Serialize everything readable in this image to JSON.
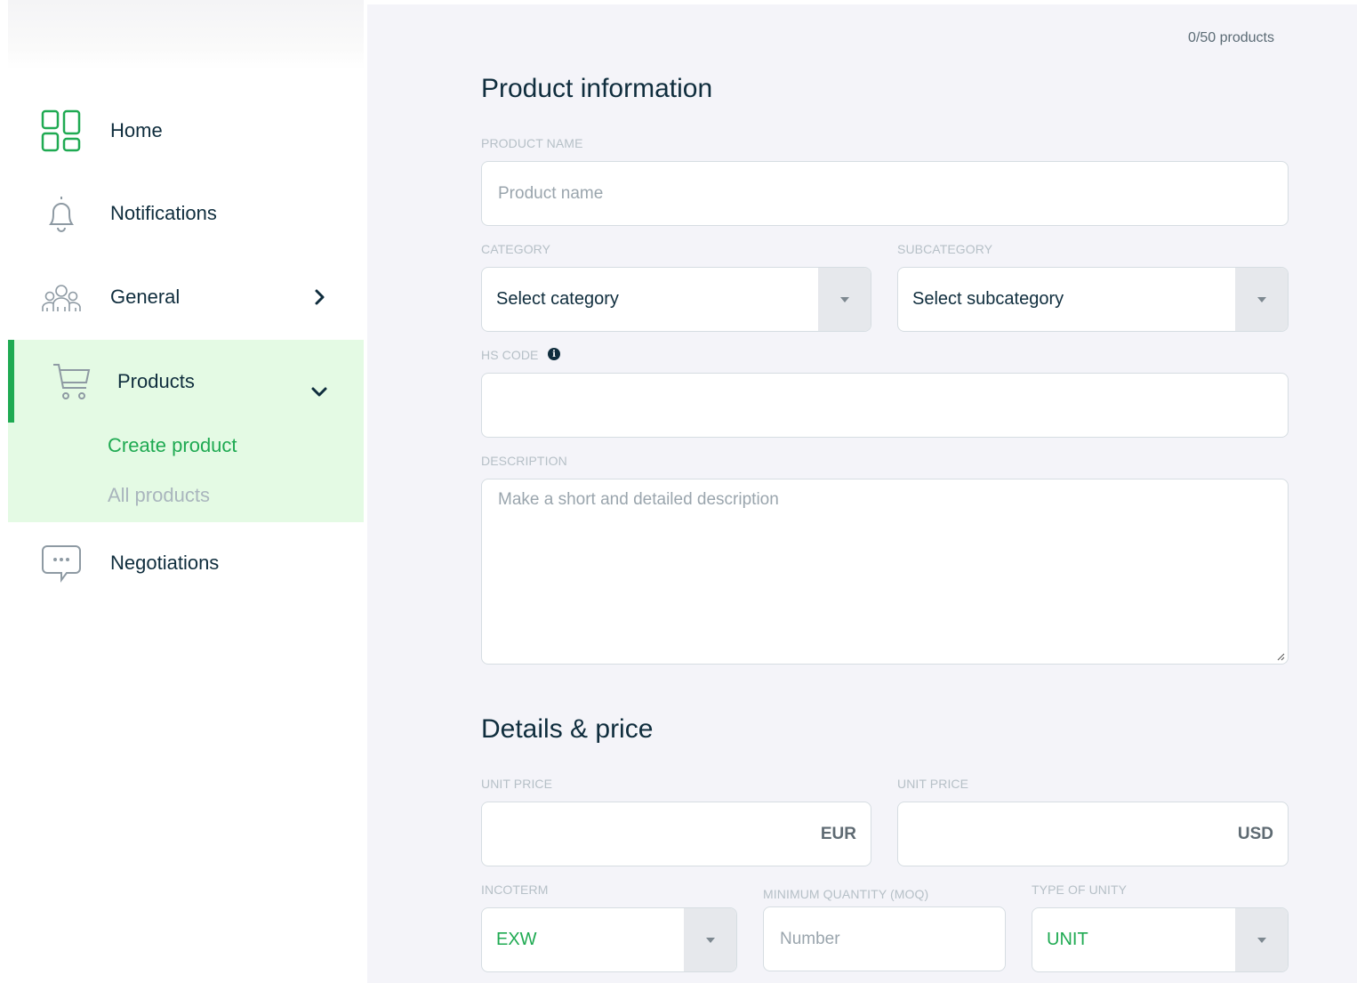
{
  "sidebar": {
    "items": [
      {
        "label": "Home",
        "icon": "dashboard-grid-icon"
      },
      {
        "label": "Notifications",
        "icon": "bell-icon"
      },
      {
        "label": "General",
        "icon": "people-group-icon"
      },
      {
        "label": "Products",
        "icon": "shopping-cart-icon"
      },
      {
        "label": "Negotiations",
        "icon": "chat-bubble-icon"
      }
    ],
    "products_submenu": [
      {
        "label": "Create product",
        "active": true
      },
      {
        "label": "All products",
        "active": false
      }
    ],
    "accent_color": "#1faa52",
    "active_bg": "#e4fae4"
  },
  "main": {
    "counter": "0/50 products",
    "product_info": {
      "title": "Product information",
      "product_name_label": "PRODUCT NAME",
      "product_name_placeholder": "Product name",
      "category_label": "CATEGORY",
      "category_value": "Select category",
      "subcategory_label": "SUBCATEGORY",
      "subcategory_value": "Select subcategory",
      "hs_code_label": "HS CODE",
      "hs_code_value": "",
      "description_label": "DESCRIPTION",
      "description_placeholder": "Make a short and detailed description"
    },
    "details_price": {
      "title": "Details & price",
      "unit_price_eur_label": "UNIT PRICE",
      "eur_currency": "EUR",
      "unit_price_usd_label": "UNIT PRICE",
      "usd_currency": "USD",
      "incoterm_label": "INCOTERM",
      "incoterm_value": "EXW",
      "moq_label": "MINIMUM QUANTITY (MOQ)",
      "moq_placeholder": "Number",
      "unit_type_label": "TYPE OF UNITY",
      "unit_type_value": "UNIT"
    }
  }
}
